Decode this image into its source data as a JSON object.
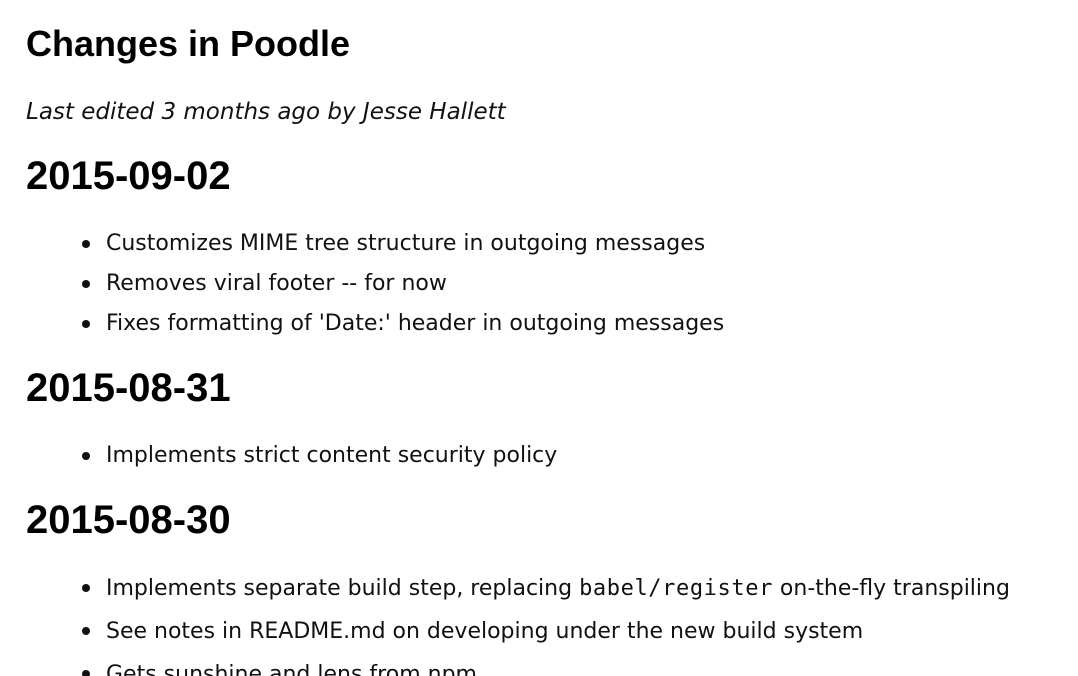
{
  "page": {
    "title": "Changes in Poodle",
    "meta": "Last edited 3 months ago by Jesse Hallett"
  },
  "sections": [
    {
      "date": "2015-09-02",
      "items": [
        "Customizes MIME tree structure in outgoing messages",
        "Removes viral footer -- for now",
        "Fixes formatting of 'Date:' header in outgoing messages"
      ]
    },
    {
      "date": "2015-08-31",
      "items": [
        "Implements strict content security policy"
      ]
    },
    {
      "date": "2015-08-30",
      "items": [
        {
          "before": "Implements separate build step, replacing ",
          "code": "babel/register",
          "after": " on-the-fly transpiling"
        },
        "See notes in README.md on developing under the new build system",
        "Gets sunshine and lens from npm"
      ]
    }
  ],
  "colors": {
    "background": "#ffffff",
    "text": "#111111",
    "heading": "#000000"
  }
}
